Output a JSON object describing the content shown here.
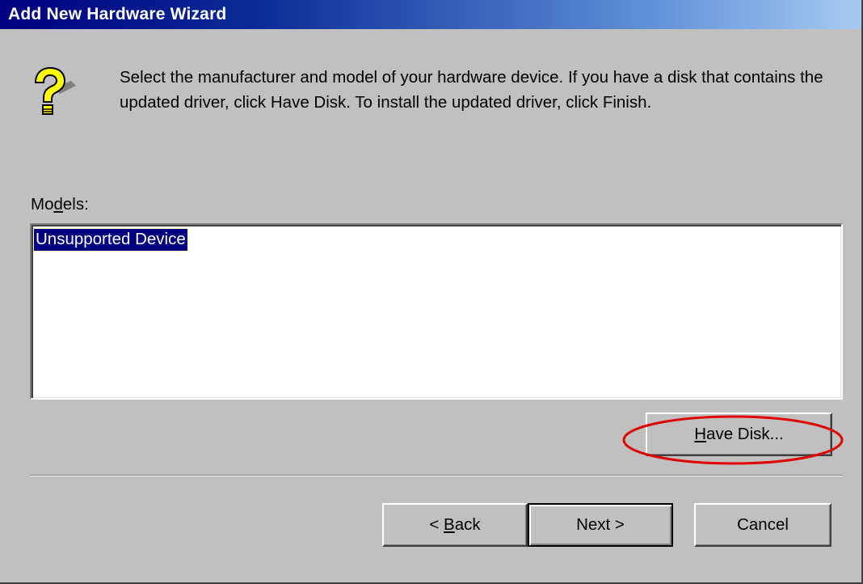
{
  "window": {
    "title": "Add New Hardware Wizard"
  },
  "wizard": {
    "icon": "question-mark-icon",
    "description": "Select the manufacturer and model of your hardware device. If you have a disk that contains the updated driver, click Have Disk. To install the updated driver, click Finish."
  },
  "models": {
    "label_pre": "Mo",
    "label_mnemonic": "d",
    "label_post": "els:",
    "items": [
      {
        "label": "Unsupported Device",
        "selected": true
      }
    ]
  },
  "buttons": {
    "have_disk": {
      "mnemonic": "H",
      "rest": "ave Disk..."
    },
    "back": {
      "prefix": "< ",
      "mnemonic": "B",
      "rest": "ack"
    },
    "next": {
      "label": "Next >"
    },
    "cancel": {
      "label": "Cancel"
    }
  },
  "annotation": {
    "highlight_color": "#e00000"
  },
  "colors": {
    "face": "#c0c0c0",
    "title_start": "#000080",
    "title_end": "#a6caf0",
    "selection": "#000080"
  }
}
